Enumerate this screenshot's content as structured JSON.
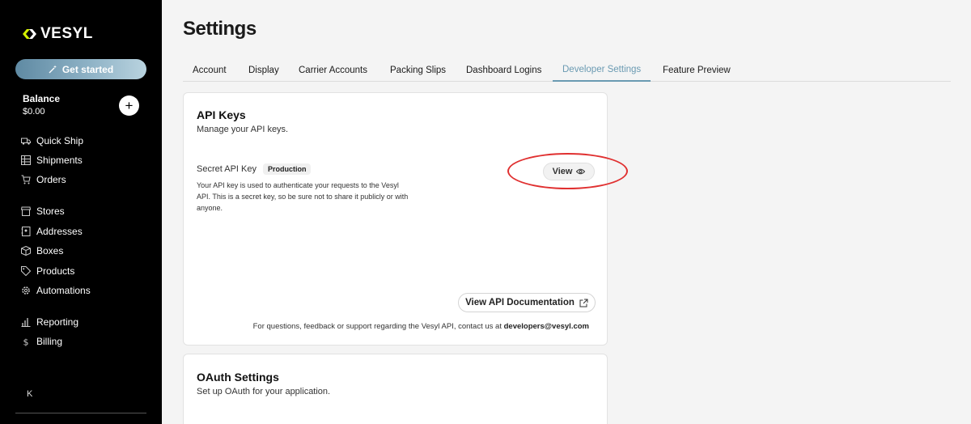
{
  "sidebar": {
    "logo_text": "VESYL",
    "get_started_label": "Get started",
    "balance_label": "Balance",
    "balance_value": "$0.00",
    "add_label": "+",
    "items": [
      {
        "label": "Quick Ship",
        "icon": "truck-icon"
      },
      {
        "label": "Shipments",
        "icon": "grid-icon"
      },
      {
        "label": "Orders",
        "icon": "cart-icon"
      },
      {
        "label": "Stores",
        "icon": "store-icon"
      },
      {
        "label": "Addresses",
        "icon": "address-book-icon"
      },
      {
        "label": "Boxes",
        "icon": "box-icon"
      },
      {
        "label": "Products",
        "icon": "tag-icon"
      },
      {
        "label": "Automations",
        "icon": "gear-icon"
      },
      {
        "label": "Reporting",
        "icon": "bar-chart-icon"
      },
      {
        "label": "Billing",
        "icon": "dollar-icon"
      }
    ],
    "collapse_label": "K"
  },
  "header": {
    "title": "Settings"
  },
  "tabs": [
    {
      "label": "Account"
    },
    {
      "label": "Display"
    },
    {
      "label": "Carrier Accounts"
    },
    {
      "label": "Packing Slips"
    },
    {
      "label": "Dashboard Logins"
    },
    {
      "label": "Developer Settings",
      "active": true
    },
    {
      "label": "Feature Preview"
    }
  ],
  "api_keys": {
    "title": "API Keys",
    "subtitle": "Manage your API keys.",
    "secret_label": "Secret API Key",
    "env_badge": "Production",
    "description": "Your API key is used to authenticate your requests to the Vesyl API. This is a secret key, so be sure not to share it publicly or with anyone.",
    "view_label": "View",
    "docs_label": "View API Documentation",
    "contact_text": "For questions, feedback or support regarding the Vesyl API, contact us at",
    "contact_email": "developers@vesyl.com"
  },
  "oauth": {
    "title": "OAuth Settings",
    "subtitle": "Set up OAuth for your application."
  },
  "colors": {
    "accent": "#6a9ab2",
    "highlight": "#e03030",
    "logo_accent": "#d4f000"
  }
}
